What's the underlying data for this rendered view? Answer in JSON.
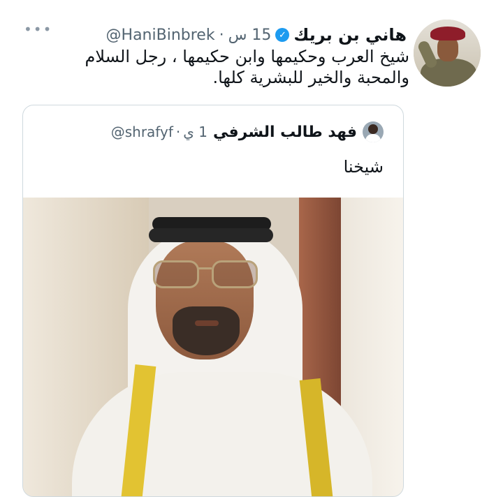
{
  "tweet": {
    "display_name": "هاني بن بريك",
    "verified_icon": "verified-badge-icon",
    "handle": "@HaniBinbrek",
    "separator": "·",
    "time": "15 س",
    "more_label": "•••",
    "text_line1": "شيخ العرب وحكيمها وابن حكيمها ، رجل السلام",
    "text_line2": "والمحبة والخير للبشرية كلها."
  },
  "quoted_tweet": {
    "display_name": "فهد طالب الشرفي",
    "handle": "@shrafyf",
    "separator": "·",
    "time": "1 ي",
    "text": "شيخنا"
  },
  "colors": {
    "verified": "#1d9bf0",
    "text_primary": "#0f1419",
    "text_secondary": "#536471",
    "border": "#cfd9de"
  }
}
